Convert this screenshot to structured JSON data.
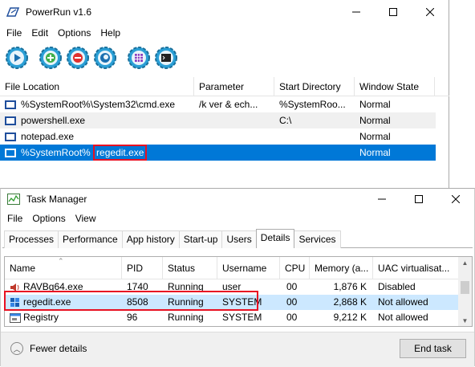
{
  "powerrun": {
    "title": "PowerRun v1.6",
    "menu": [
      "File",
      "Edit",
      "Options",
      "Help"
    ],
    "toolbar": [
      "run-icon",
      "add-icon",
      "remove-icon",
      "refresh-icon",
      "grid-icon",
      "console-icon"
    ],
    "columns": [
      "File Location",
      "Parameter",
      "Start Directory",
      "Window State"
    ],
    "rows": [
      {
        "location": "%SystemRoot%\\System32\\cmd.exe",
        "parameter": "/k ver & ech...",
        "start_dir": "%SystemRoo...",
        "state": "Normal"
      },
      {
        "location": "powershell.exe",
        "parameter": "",
        "start_dir": "C:\\",
        "state": "Normal"
      },
      {
        "location": "notepad.exe",
        "parameter": "",
        "start_dir": "",
        "state": "Normal"
      },
      {
        "location_prefix": "%SystemRoot%",
        "location_highlight": "regedit.exe",
        "parameter": "",
        "start_dir": "",
        "state": "Normal",
        "selected": true
      }
    ]
  },
  "taskmgr": {
    "title": "Task Manager",
    "menu": [
      "File",
      "Options",
      "View"
    ],
    "tabs": [
      "Processes",
      "Performance",
      "App history",
      "Start-up",
      "Users",
      "Details",
      "Services"
    ],
    "active_tab": "Details",
    "columns": [
      "Name",
      "PID",
      "Status",
      "Username",
      "CPU",
      "Memory (a...",
      "UAC virtualisat..."
    ],
    "rows": [
      {
        "name": "RAVBg64.exe",
        "pid": "1740",
        "status": "Running",
        "user": "user",
        "cpu": "00",
        "mem": "1,876 K",
        "uac": "Disabled"
      },
      {
        "name": "regedit.exe",
        "pid": "8508",
        "status": "Running",
        "user": "SYSTEM",
        "cpu": "00",
        "mem": "2,868 K",
        "uac": "Not allowed",
        "selected": true
      },
      {
        "name": "Registry",
        "pid": "96",
        "status": "Running",
        "user": "SYSTEM",
        "cpu": "00",
        "mem": "9,212 K",
        "uac": "Not allowed"
      }
    ],
    "fewer_details": "Fewer details",
    "end_task": "End task"
  },
  "colors": {
    "selection": "#0078d7",
    "highlight": "#e81123",
    "tm_selection": "#cce8ff"
  }
}
